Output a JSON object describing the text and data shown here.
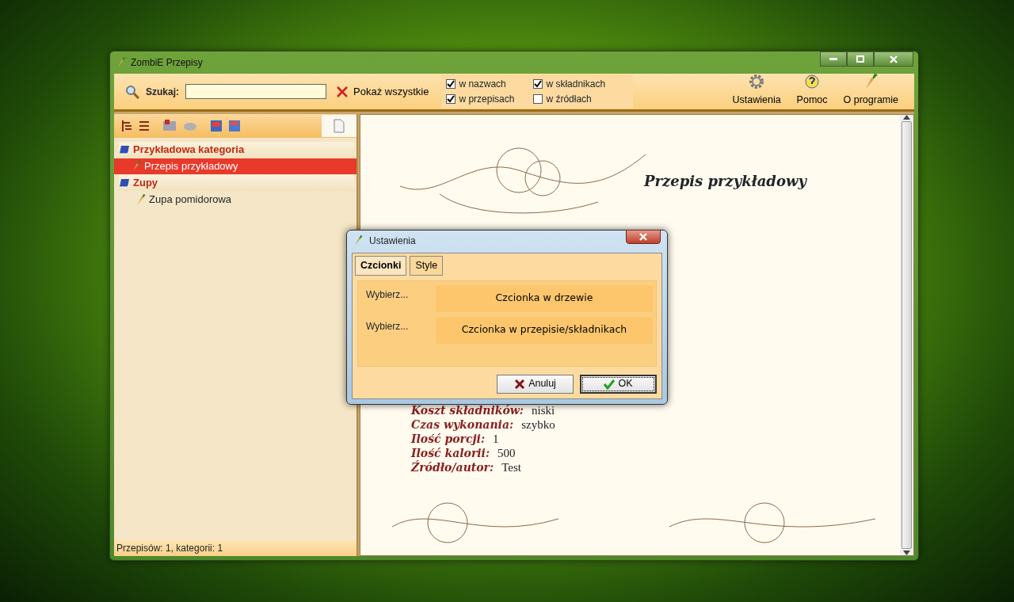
{
  "window": {
    "title": "ZombiE Przepisy"
  },
  "search": {
    "label": "Szukaj:",
    "show_all": "Pokaż wszystkie"
  },
  "filters": [
    {
      "label": "w nazwach",
      "checked": true
    },
    {
      "label": "w przepisach",
      "checked": true
    },
    {
      "label": "w składnikach",
      "checked": true
    },
    {
      "label": "w źródłach",
      "checked": false
    }
  ],
  "toolbar_buttons": [
    {
      "label": "Ustawienia",
      "kind": "settings"
    },
    {
      "label": "Pomoc",
      "kind": "help"
    },
    {
      "label": "O programie",
      "kind": "about"
    }
  ],
  "tree": [
    {
      "label": "Przykładowa kategoria",
      "selected": false,
      "children": [
        {
          "label": "Przepis przykładowy",
          "selected": true
        }
      ]
    },
    {
      "label": "Zupy",
      "selected": false,
      "children": [
        {
          "label": "Zupa pomidorowa",
          "selected": false
        }
      ]
    }
  ],
  "status_bar": "Przepisów: 1, kategorii: 1",
  "recipe": {
    "title": "Przepis przykładowy",
    "details": [
      {
        "label": "Koszt składników:",
        "value": "niski"
      },
      {
        "label": "Czas wykonania:",
        "value": "szybko"
      },
      {
        "label": "Ilość porcji:",
        "value": "1"
      },
      {
        "label": "Ilość kalorii:",
        "value": "500"
      },
      {
        "label": "Źródło/autor:",
        "value": "Test"
      }
    ]
  },
  "dialog": {
    "title": "Ustawienia",
    "tabs": [
      {
        "label": "Czcionki",
        "selected": true
      },
      {
        "label": "Style",
        "selected": false
      }
    ],
    "rows": [
      {
        "label": "Wybierz...",
        "button": "Czcionka w drzewie"
      },
      {
        "label": "Wybierz...",
        "button": "Czcionka w przepisie/składnikach"
      }
    ],
    "buttons": [
      {
        "label": "Anuluj",
        "kind": "cancel",
        "focused": false
      },
      {
        "label": "OK",
        "kind": "ok",
        "focused": true
      }
    ]
  }
}
